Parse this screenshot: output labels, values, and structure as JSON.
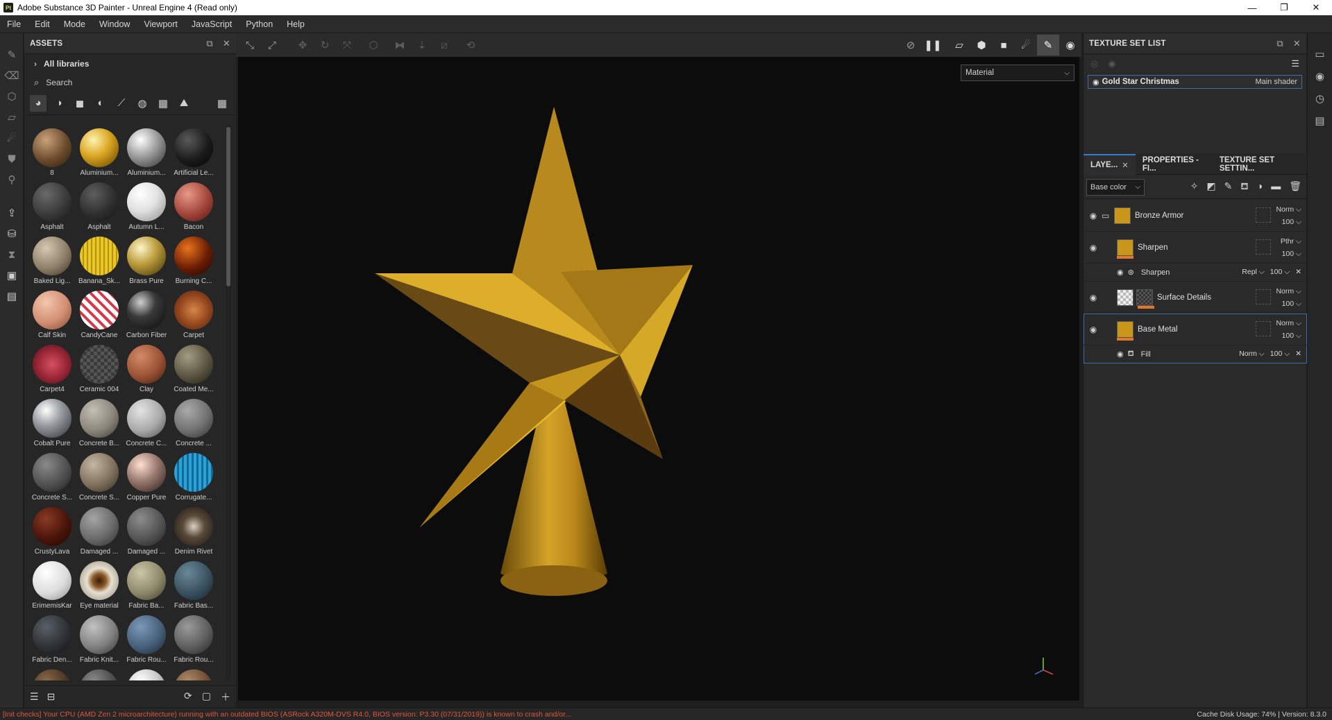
{
  "window": {
    "title": "Adobe Substance 3D Painter - Unreal Engine 4 (Read only)",
    "logo_text": "Pt",
    "controls": [
      "—",
      "❐",
      "✕"
    ]
  },
  "menu": [
    "File",
    "Edit",
    "Mode",
    "Window",
    "Viewport",
    "JavaScript",
    "Python",
    "Help"
  ],
  "assets": {
    "title": "ASSETS",
    "libraries": "All libraries",
    "search_placeholder": "Search",
    "items": [
      {
        "label": "8",
        "bg": "radial-gradient(circle at 35% 30%, #c9a27a, #6b4a2c 55%, #2a1a0c)"
      },
      {
        "label": "Aluminium...",
        "bg": "radial-gradient(circle at 35% 30%, #fff3b0, #d9a520 45%, #5a3a00)"
      },
      {
        "label": "Aluminium...",
        "bg": "radial-gradient(circle at 35% 30%, #ffffff, #a8a8a8 40%, #2a2a2a)"
      },
      {
        "label": "Artificial Le...",
        "bg": "radial-gradient(circle at 35% 30%, #5a5a5a, #1a1a1a 55%, #050505)"
      },
      {
        "label": "Asphalt",
        "bg": "radial-gradient(circle at 35% 30%, #6a6a6a, #3a3a3a 55%, #141414)"
      },
      {
        "label": "Asphalt",
        "bg": "radial-gradient(circle at 35% 30%, #5e5e5e, #2e2e2e 55%, #121212)"
      },
      {
        "label": "Autumn L...",
        "bg": "radial-gradient(circle at 35% 30%, #ffffff, #e2e2e2 45%, #8a8a8a)"
      },
      {
        "label": "Bacon",
        "bg": "radial-gradient(circle at 35% 30%, #e79a88, #a2443a 55%, #4a1410)"
      },
      {
        "label": "Baked Lig...",
        "bg": "radial-gradient(circle at 35% 30%, #d6c8b2, #8d7e68 55%, #3a3024)"
      },
      {
        "label": "Banana_Sk...",
        "bg": "repeating-linear-gradient(90deg, #e8c72a 0 4px, #b79206 4px 6px)"
      },
      {
        "label": "Brass Pure",
        "bg": "radial-gradient(circle at 35% 30%, #fff6c8, #b99a3a 45%, #3a2c08)"
      },
      {
        "label": "Burning C...",
        "bg": "radial-gradient(circle at 35% 30%, #e8731c, #6a1c04 55%, #1a0400)"
      },
      {
        "label": "Calf Skin",
        "bg": "radial-gradient(circle at 35% 30%, #f4c6ae, #d28e72 55%, #7a4632)"
      },
      {
        "label": "CandyCane",
        "bg": "repeating-linear-gradient(45deg, #ffffff 0 6px, #d63a4a 6px 10px)"
      },
      {
        "label": "Carbon Fiber",
        "bg": "radial-gradient(circle at 35% 30%, #d0d0d0, #3a3a3a 40%, #080808)"
      },
      {
        "label": "Carpet",
        "bg": "radial-gradient(circle at 50% 50%, #d2884a, #9a4a20 50%, #4a200c)"
      },
      {
        "label": "Carpet4",
        "bg": "radial-gradient(circle at 50% 50%, #d65060, #9c2838 50%, #4a0c14)"
      },
      {
        "label": "Ceramic 004",
        "bg": "repeating-conic-gradient(#3a3a3a 0 25%, #555 0 50%) 0 0/10px 10px"
      },
      {
        "label": "Clay",
        "bg": "radial-gradient(circle at 35% 30%, #d38a68, #9a5234 55%, #3a1a0c)"
      },
      {
        "label": "Coated Me...",
        "bg": "radial-gradient(circle at 35% 30%, #a39c84, #5a5440 55%, #1e1c12)"
      },
      {
        "label": "Cobalt Pure",
        "bg": "radial-gradient(circle at 35% 30%, #ffffff, #9a9ea2 40%, #2a2c30)"
      },
      {
        "label": "Concrete B...",
        "bg": "radial-gradient(circle at 35% 30%, #c4bfb4, #8a857a 55%, #3a3630)"
      },
      {
        "label": "Concrete C...",
        "bg": "radial-gradient(circle at 35% 30%, #e4e4e4, #a8a8a8 55%, #4a4a4a)"
      },
      {
        "label": "Concrete ...",
        "bg": "radial-gradient(circle at 35% 30%, #aaaaaa, #707070 55%, #2c2c2c)"
      },
      {
        "label": "Concrete S...",
        "bg": "radial-gradient(circle at 35% 30%, #8a8a8a, #505050 55%, #1e1e1e)"
      },
      {
        "label": "Concrete S...",
        "bg": "radial-gradient(circle at 35% 30%, #c4b6a2, #7e705c 55%, #302a20)"
      },
      {
        "label": "Copper Pure",
        "bg": "radial-gradient(circle at 35% 30%, #ffe0d0, #9a7a70 45%, #2a1a14)"
      },
      {
        "label": "Corrugate...",
        "bg": "repeating-linear-gradient(90deg, #2aa4d8 0 4px, #146a94 4px 7px)"
      },
      {
        "label": "CrustyLava",
        "bg": "radial-gradient(circle at 35% 30%, #8a3a24, #4a140a 55%, #1a0602)"
      },
      {
        "label": "Damaged ...",
        "bg": "radial-gradient(circle at 35% 30%, #a4a4a4, #6a6a6a 55%, #2a2a2a)"
      },
      {
        "label": "Damaged ...",
        "bg": "radial-gradient(circle at 35% 30%, #8c8c8c, #545454 55%, #202020)"
      },
      {
        "label": "Denim Rivet",
        "bg": "radial-gradient(circle at 50% 50%, #d8d0c4, #5a4a3a 40%, #1a140e)"
      },
      {
        "label": "ErimemisKar",
        "bg": "radial-gradient(circle at 35% 30%, #ffffff, #dcdcdc 55%, #8a8a8a)"
      },
      {
        "label": "Eye material",
        "bg": "radial-gradient(circle at 50% 50%, #3a1a08, #8a5a2a 25%, #e8e0d0 45%, #8a8474)"
      },
      {
        "label": "Fabric Ba...",
        "bg": "radial-gradient(circle at 35% 30%, #cbc6a8, #8e886a 55%, #3a3624)"
      },
      {
        "label": "Fabric Bas...",
        "bg": "radial-gradient(circle at 35% 30%, #6a8898, #3a5260 55%, #142028)"
      },
      {
        "label": "Fabric Den...",
        "bg": "radial-gradient(circle at 35% 30%, #5a6066, #2e3236 55%, #0e1012)"
      },
      {
        "label": "Fabric Knit...",
        "bg": "radial-gradient(circle at 35% 30%, #c2c2c2, #808080 55%, #303030)"
      },
      {
        "label": "Fabric Rou...",
        "bg": "radial-gradient(circle at 35% 30%, #7a98b8, #46607a 55%, #18222e)"
      },
      {
        "label": "Fabric Rou...",
        "bg": "radial-gradient(circle at 35% 30%, #9a9a9a, #5e5e5e 55%, #222222)"
      },
      {
        "label": "",
        "bg": "radial-gradient(circle at 35% 30%, #8a6a4a, #4a3420 55%, #1a120a)"
      },
      {
        "label": "",
        "bg": "radial-gradient(circle at 35% 30%, #8a8a8a, #4a4a4a 55%, #1a1a1a)"
      },
      {
        "label": "",
        "bg": "radial-gradient(circle at 35% 30%, #ffffff, #cccccc 45%, #5a5a5a)"
      },
      {
        "label": "",
        "bg": "radial-gradient(circle at 35% 30%, #b08a6a, #6a4a30 55%, #2a1a10)"
      }
    ]
  },
  "viewport": {
    "material_mode": "Material"
  },
  "texture_set": {
    "title": "TEXTURE SET LIST",
    "item_name": "Gold Star Christmas",
    "item_shader": "Main shader"
  },
  "tabs": {
    "layers": "LAYE...",
    "properties": "PROPERTIES - FI...",
    "settings": "TEXTURE SET SETTIN..."
  },
  "layers_panel": {
    "channel": "Base color",
    "layers": [
      {
        "name": "Bronze Armor",
        "blend": "Norm",
        "opacity": "100"
      },
      {
        "name": "Sharpen",
        "blend": "Pthr",
        "opacity": "100"
      },
      {
        "name": "Surface Details",
        "blend": "Norm",
        "opacity": "100"
      },
      {
        "name": "Base Metal",
        "blend": "Norm",
        "opacity": "100"
      }
    ],
    "sublayers": [
      {
        "name": "Sharpen",
        "blend": "Repl",
        "opacity": "100"
      },
      {
        "name": "Fill",
        "blend": "Norm",
        "opacity": "100"
      }
    ]
  },
  "status": {
    "message": "[Init checks] Your CPU (AMD Zen 2 microarchitecture) running with an outdated BIOS (ASRock A320M-DVS R4.0, BIOS version: P3.30 (07/31/2019)) is known to crash and/or...",
    "right": "Cache Disk Usage:    74% | Version: 8.3.0"
  },
  "colors": {
    "accent": "#3a7bd5",
    "gold": "#c9961c",
    "error": "#e0573c"
  }
}
